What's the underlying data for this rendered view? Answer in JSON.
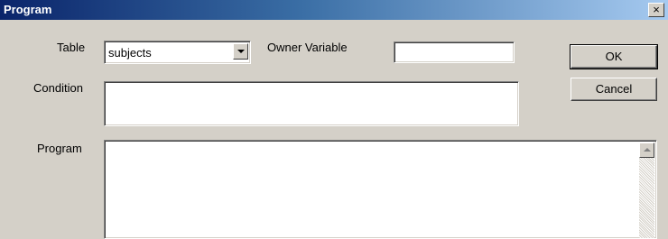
{
  "window": {
    "title": "Program",
    "close_glyph": "×"
  },
  "form": {
    "table_label": "Table",
    "table_value": "subjects",
    "owner_variable_label": "Owner Variable",
    "owner_variable_value": "",
    "condition_label": "Condition",
    "condition_value": "",
    "program_label": "Program",
    "program_value": ""
  },
  "buttons": {
    "ok_label": "OK",
    "cancel_label": "Cancel"
  },
  "colors": {
    "face": "#d4d0c8",
    "title_start": "#0a246a",
    "title_end": "#a6caf0"
  },
  "icons": {
    "combo_arrow": "chevron-down-icon",
    "scroll_up": "scroll-up-arrow-icon",
    "close": "close-icon"
  }
}
